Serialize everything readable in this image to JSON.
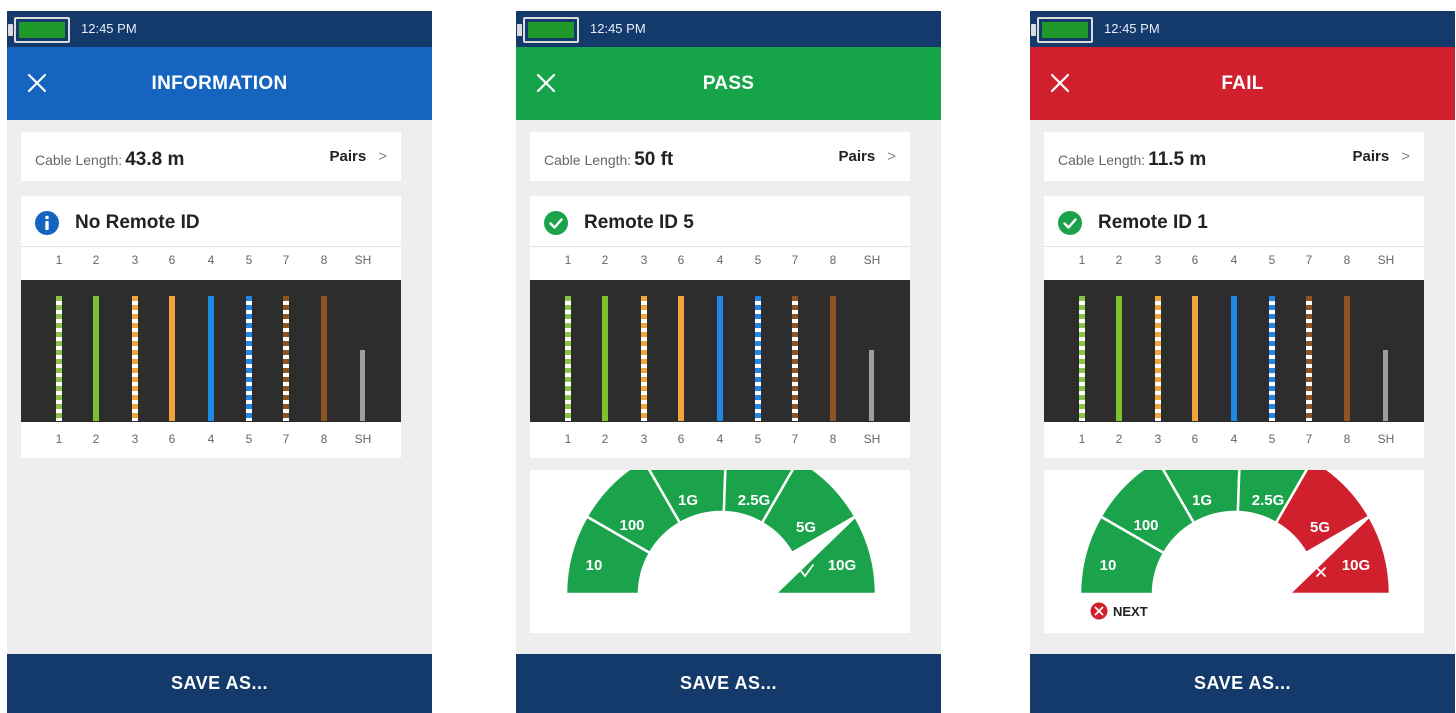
{
  "screens": [
    {
      "time": "12:45 PM",
      "title": "INFORMATION",
      "header_color": "#1565c0",
      "cable_length_label": "Cable Length:",
      "cable_length_value": "43.8 m",
      "pairs_label": "Pairs",
      "remote_status": "info",
      "remote_label": "No Remote ID",
      "pins": [
        "1",
        "2",
        "3",
        "6",
        "4",
        "5",
        "7",
        "8",
        "SH"
      ],
      "save_label": "SAVE AS..."
    },
    {
      "time": "12:45 PM",
      "title": "PASS",
      "header_color": "#16a44a",
      "cable_length_label": "Cable Length:",
      "cable_length_value": "50 ft",
      "pairs_label": "Pairs",
      "remote_status": "ok",
      "remote_label": "Remote ID 5",
      "pins": [
        "1",
        "2",
        "3",
        "6",
        "4",
        "5",
        "7",
        "8",
        "SH"
      ],
      "gauge": {
        "segments": [
          {
            "label": "10",
            "status": "pass"
          },
          {
            "label": "100",
            "status": "pass"
          },
          {
            "label": "1G",
            "status": "pass"
          },
          {
            "label": "2.5G",
            "status": "pass"
          },
          {
            "label": "5G",
            "status": "pass"
          },
          {
            "label": "10G",
            "status": "pass",
            "mark": "check"
          }
        ]
      },
      "save_label": "SAVE AS..."
    },
    {
      "time": "12:45 PM",
      "title": "FAIL",
      "header_color": "#d0202e",
      "cable_length_label": "Cable Length:",
      "cable_length_value": "11.5 m",
      "pairs_label": "Pairs",
      "remote_status": "ok",
      "remote_label": "Remote ID 1",
      "pins": [
        "1",
        "2",
        "3",
        "6",
        "4",
        "5",
        "7",
        "8",
        "SH"
      ],
      "gauge": {
        "segments": [
          {
            "label": "10",
            "status": "pass"
          },
          {
            "label": "100",
            "status": "pass"
          },
          {
            "label": "1G",
            "status": "pass"
          },
          {
            "label": "2.5G",
            "status": "pass"
          },
          {
            "label": "5G",
            "status": "fail"
          },
          {
            "label": "10G",
            "status": "fail",
            "mark": "cross"
          }
        ],
        "next_label": "NEXT"
      },
      "save_label": "SAVE AS..."
    }
  ],
  "wires": [
    {
      "color": "#8bc34a",
      "stripe": "#ffffff"
    },
    {
      "color": "#7cc22f",
      "stripe": null
    },
    {
      "color": "#f0a63a",
      "stripe": "#ffffff"
    },
    {
      "color": "#f0a63a",
      "stripe": null
    },
    {
      "color": "#1e88e5",
      "stripe": null
    },
    {
      "color": "#1e88e5",
      "stripe": "#ffffff"
    },
    {
      "color": "#8d5524",
      "stripe": "#ffffff"
    },
    {
      "color": "#8d5524",
      "stripe": null
    },
    {
      "color": "#9e9e9e",
      "stripe": null,
      "shield": true
    }
  ],
  "colors": {
    "pass": "#1aa34a",
    "fail": "#d0202e",
    "info_icon": "#1565c0",
    "ok_icon": "#1aa34a",
    "navy": "#143a6b"
  }
}
